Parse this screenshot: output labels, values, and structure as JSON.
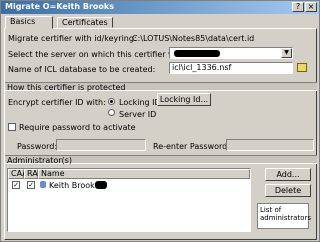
{
  "window": {
    "title": "Migrate O=Keith Brooks"
  },
  "tabs": [
    {
      "label": "Basics"
    },
    {
      "label": "Certificates"
    }
  ],
  "form": {
    "certifier_label": "Migrate certifier with id/keyring:",
    "certifier_path": "C:\\LOTUS\\Notes85\\data\\cert.id",
    "server_label": "Select the server on which this certifier will run:",
    "database_label": "Name of ICL database to be created:",
    "database_value": "icl\\icl_1336.nsf"
  },
  "protection": {
    "section_label": "How this certifier is protected",
    "encrypt_label": "Encrypt certifier ID with:",
    "locking_id_label": "Locking ID",
    "server_id_label": "Server ID",
    "locking_id_button": "Locking Id...",
    "require_password_label": "Require password to activate",
    "password_label": "Password:",
    "reenter_label": "Re-enter Password:"
  },
  "admins": {
    "section_label": "Administrator(s)",
    "columns": [
      "CAA",
      "RA",
      "Name"
    ],
    "rows": [
      {
        "caa": true,
        "ra": true,
        "name": "Keith Brook"
      }
    ],
    "add_button": "Add...",
    "delete_button": "Delete",
    "help_text": "List of administrators"
  },
  "colors": {
    "titlebar": "#3a6ea5",
    "dialog_bg": "#d4d0c8"
  }
}
